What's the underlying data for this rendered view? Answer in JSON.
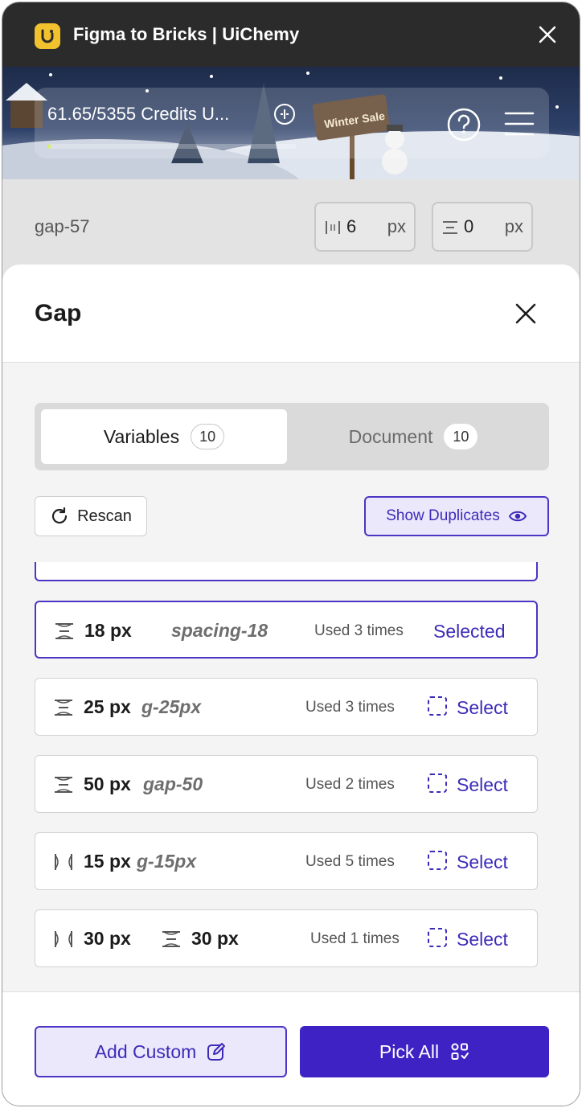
{
  "window": {
    "title": "Figma to Bricks | UiChemy"
  },
  "banner": {
    "credits_text": "61.65/5355 Credits U...",
    "credits_used_fraction": 0.0115,
    "sign_text": "Winter Sale"
  },
  "background_row": {
    "label": "gap-57",
    "column_value": "6",
    "row_value": "0",
    "unit": "px"
  },
  "modal": {
    "title": "Gap",
    "tabs": [
      {
        "label": "Variables",
        "count": "10",
        "active": true
      },
      {
        "label": "Document",
        "count": "10",
        "active": false
      }
    ],
    "rescan_label": "Rescan",
    "show_duplicates_label": "Show Duplicates",
    "items": [
      {
        "icon": "row-gap-icon",
        "value": "18 px",
        "alias": "spacing-18",
        "used": "Used 3 times",
        "action": "Selected",
        "selected": true
      },
      {
        "icon": "row-gap-icon",
        "value": "25 px",
        "alias": "g-25px",
        "used": "Used 3 times",
        "action": "Select",
        "selected": false
      },
      {
        "icon": "row-gap-icon",
        "value": "50 px",
        "alias": "gap-50",
        "used": "Used 2 times",
        "action": "Select",
        "selected": false
      },
      {
        "icon": "column-gap-icon",
        "value": "15 px",
        "alias": "g-15px",
        "used": "Used 5 times",
        "action": "Select",
        "selected": false
      },
      {
        "icon": "column-gap-icon",
        "value": "30 px",
        "value2": "30 px",
        "used": "Used 1 times",
        "action": "Select",
        "selected": false
      }
    ],
    "add_custom_label": "Add Custom",
    "pick_all_label": "Pick All"
  },
  "colors": {
    "accent": "#3f22c4",
    "accent_light": "#ece8fb",
    "titlebar": "#2b2b2b",
    "logo": "#f2c12e"
  }
}
